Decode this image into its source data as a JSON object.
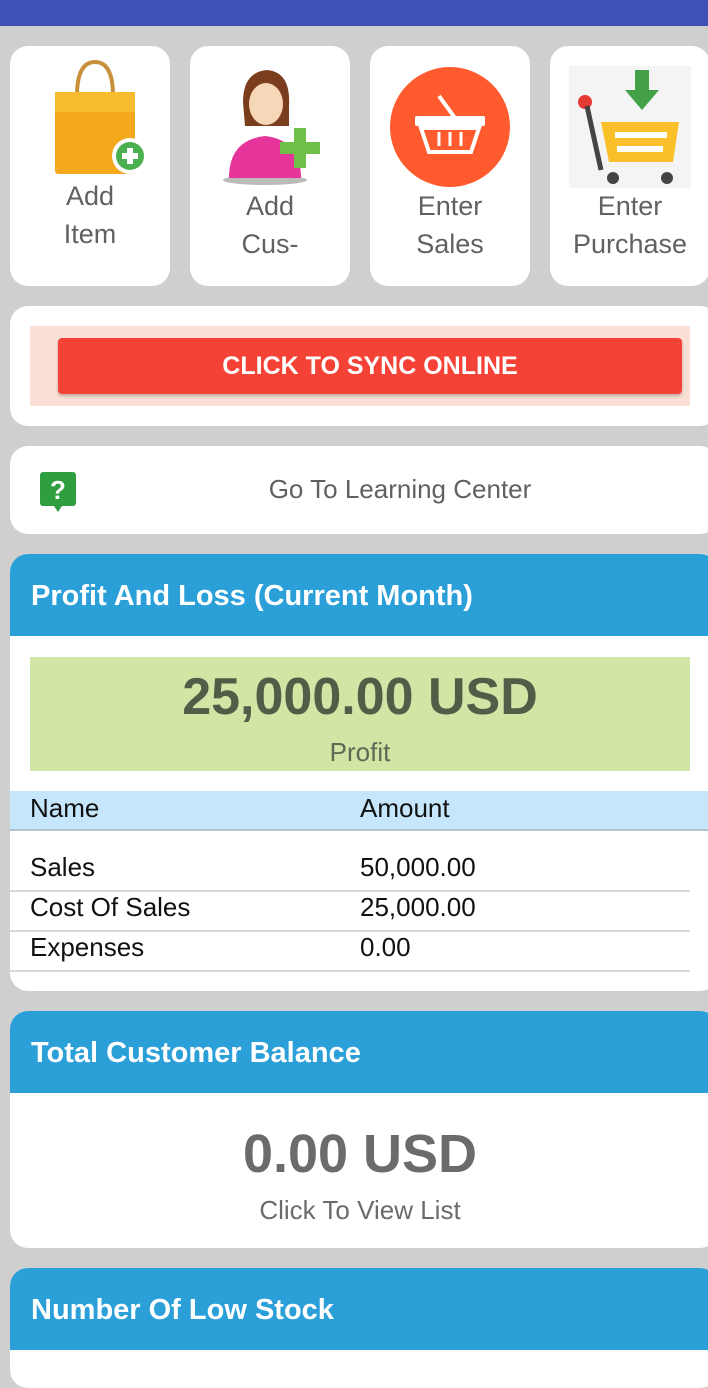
{
  "tiles": [
    {
      "line1": "Add",
      "line2": "Item",
      "icon": "shopping-bag-add-icon"
    },
    {
      "line1": "Add",
      "line2": "Cus-",
      "icon": "add-customer-icon"
    },
    {
      "line1": "Enter",
      "line2": "Sales",
      "icon": "basket-icon"
    },
    {
      "line1": "Enter",
      "line2": "Purchase",
      "icon": "cart-download-icon"
    }
  ],
  "sync": {
    "label": "CLICK TO SYNC ONLINE"
  },
  "learning": {
    "label": "Go To Learning Center",
    "icon": "help-icon"
  },
  "profit_loss": {
    "title": "Profit And Loss (Current Month)",
    "amount": "25,000.00 USD",
    "status": "Profit",
    "columns": [
      "Name",
      "Amount"
    ],
    "rows": [
      {
        "name": "Sales",
        "amount": "50,000.00"
      },
      {
        "name": "Cost Of Sales",
        "amount": "25,000.00"
      },
      {
        "name": "Expenses",
        "amount": "0.00"
      }
    ]
  },
  "customer_balance": {
    "title": "Total Customer Balance",
    "amount": "0.00 USD",
    "link": "Click To View List"
  },
  "low_stock": {
    "title": "Number Of Low Stock"
  },
  "colors": {
    "topbar": "#3f51b5",
    "header": "#2a9fd8",
    "sync": "#f44336",
    "profit_bg": "#d1e5a5"
  }
}
